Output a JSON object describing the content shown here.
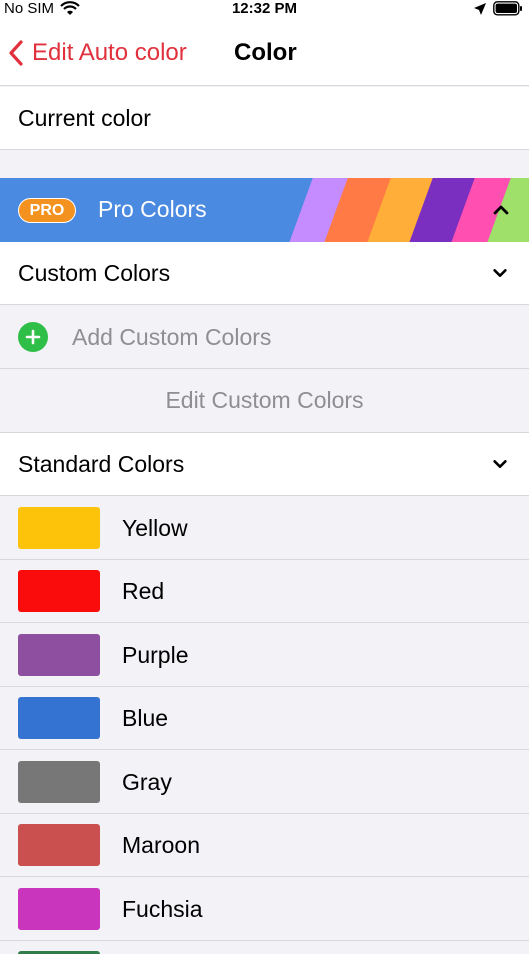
{
  "status": {
    "carrier": "No SIM",
    "time": "12:32 PM"
  },
  "nav": {
    "back_label": "Edit Auto color",
    "title": "Color"
  },
  "current_color_label": "Current color",
  "pro": {
    "badge": "PRO",
    "label": "Pro Colors"
  },
  "custom": {
    "header": "Custom Colors",
    "add_label": "Add Custom Colors",
    "edit_label": "Edit Custom Colors"
  },
  "standard": {
    "header": "Standard Colors",
    "colors": [
      {
        "name": "Yellow",
        "hex": "#fcc30a"
      },
      {
        "name": "Red",
        "hex": "#fb0c0c"
      },
      {
        "name": "Purple",
        "hex": "#8e4fa1"
      },
      {
        "name": "Blue",
        "hex": "#3473d1"
      },
      {
        "name": "Gray",
        "hex": "#777777"
      },
      {
        "name": "Maroon",
        "hex": "#c9504f"
      },
      {
        "name": "Fuchsia",
        "hex": "#c935bd"
      }
    ]
  },
  "accent": "#e0313d"
}
